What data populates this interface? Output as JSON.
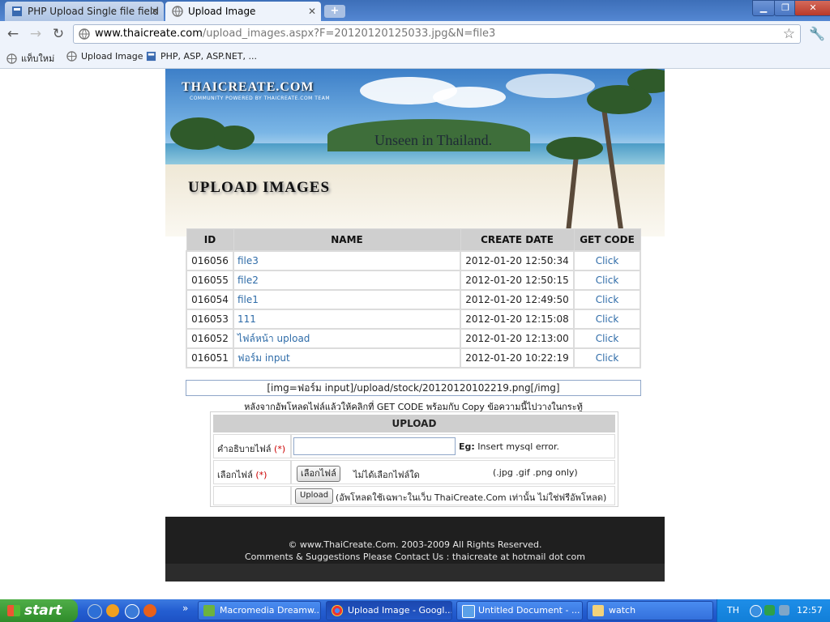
{
  "browser": {
    "tabs": [
      {
        "label": "PHP Upload Single file field",
        "active": false
      },
      {
        "label": "Upload Image",
        "active": true
      }
    ],
    "new_tab_label": "+",
    "url_host": "www.thaicreate.com",
    "url_path": "/upload_images.aspx?F=20120120125033.jpg&N=file3",
    "bookmarks": [
      {
        "label": "แท็บใหม่",
        "icon": "globe-icon"
      },
      {
        "label": "Upload Image",
        "icon": "globe-icon"
      },
      {
        "label": "PHP, ASP, ASP.NET, ...",
        "icon": "thaicreate-icon"
      }
    ]
  },
  "banner": {
    "logo": "THAICREATE.COM",
    "logo_sub": "COMMUNITY POWERED BY THAICREATE.COM TEAM",
    "tagline": "Unseen in Thailand.",
    "heading": "UPLOAD IMAGES"
  },
  "table": {
    "headers": [
      "ID",
      "NAME",
      "CREATE DATE",
      "GET CODE"
    ],
    "rows": [
      {
        "id": "016056",
        "name": "file3",
        "date": "2012-01-20 12:50:34",
        "action": "Click"
      },
      {
        "id": "016055",
        "name": "file2",
        "date": "2012-01-20 12:50:15",
        "action": "Click"
      },
      {
        "id": "016054",
        "name": "file1",
        "date": "2012-01-20 12:49:50",
        "action": "Click"
      },
      {
        "id": "016053",
        "name": "111",
        "date": "2012-01-20 12:15:08",
        "action": "Click"
      },
      {
        "id": "016052",
        "name": "ไฟล์หน้า upload",
        "date": "2012-01-20 12:13:00",
        "action": "Click"
      },
      {
        "id": "016051",
        "name": "ฟอร์ม input",
        "date": "2012-01-20 10:22:19",
        "action": "Click"
      }
    ]
  },
  "code_box": "[img=ฟอร์ม input]/upload/stock/20120120102219.png[/img]",
  "hint": "หลังจากอัพโหลดไฟล์แล้วให้คลิกที่ GET CODE พร้อมกับ Copy ข้อความนี้ไปวางในกระทู้",
  "upload": {
    "title": "UPLOAD",
    "desc_label": "คำอธิบายไฟล์",
    "required_mark": "(*)",
    "desc_value": "",
    "eg_label": "Eg:",
    "eg_text": "Insert mysql error.",
    "file_label": "เลือกไฟล์",
    "choose_button": "เลือกไฟล์",
    "no_file": "ไม่ได้เลือกไฟล์ใด",
    "allowed_ext": "(.jpg .gif .png only)",
    "upload_button": "Upload",
    "upload_note": "(อัพโหลดใช้เฉพาะในเว็บ ThaiCreate.Com เท่านั้น ไม่ใช่ฟรีอัพโหลด)"
  },
  "footer": {
    "copyright": "© www.ThaiCreate.Com. 2003-2009 All Rights Reserved.",
    "contact": "Comments & Suggestions Please Contact Us : thaicreate at hotmail dot com"
  },
  "taskbar": {
    "start": "start",
    "items": [
      {
        "label": "Macromedia Dreamw...",
        "active": false
      },
      {
        "label": "Upload Image - Googl...",
        "active": true
      },
      {
        "label": "Untitled Document - ...",
        "active": false
      },
      {
        "label": "watch",
        "active": false
      }
    ],
    "overflow": "»",
    "lang": "TH",
    "time": "12:57"
  },
  "colors": {
    "link": "#2f6ca8",
    "header_gray": "#cfcfcf",
    "footer_bg": "#1f1f1f",
    "taskbar_blue": "#245ed1",
    "start_green": "#3a9a34"
  }
}
